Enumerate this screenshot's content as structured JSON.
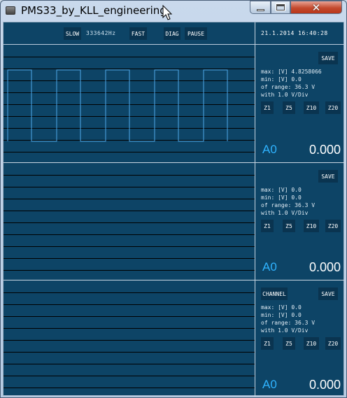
{
  "window": {
    "title": "PMS33_by_KLL_engineering",
    "close_glyph": "✕"
  },
  "toolbar": {
    "slow_label": "SLOW",
    "frequency": "333642Hz",
    "fast_label": "FAST",
    "diag_label": "DIAG",
    "pause_label": "PAUSE",
    "datetime": "21.1.2014 16:40:28"
  },
  "channels": [
    {
      "save_label": "SAVE",
      "max_line": "max: [V] 4.8258066",
      "min_line": "min: [V] 0.0",
      "range_line": "of range: 36.3 V",
      "div_line": "with 1.0 V/Div",
      "zoom": [
        "Z1",
        "Z5",
        "Z10",
        "Z20"
      ],
      "name": "A0",
      "value": "0.000"
    },
    {
      "save_label": "SAVE",
      "max_line": "max: [V] 0.0",
      "min_line": "min: [V] 0.0",
      "range_line": "of range: 36.3 V",
      "div_line": "with 1.0 V/Div",
      "zoom": [
        "Z1",
        "Z5",
        "Z10",
        "Z20"
      ],
      "name": "A0",
      "value": "0.000"
    },
    {
      "channel_label": "CHANNEL",
      "save_label": "SAVE",
      "max_line": "max: [V] 0.0",
      "min_line": "min: [V] 0.0",
      "range_line": "of range: 36.3 V",
      "div_line": "with 1.0 V/Div",
      "zoom": [
        "Z1",
        "Z5",
        "Z10",
        "Z20"
      ],
      "name": "A0",
      "value": "0.000"
    }
  ],
  "colors": {
    "background": "#0d4466",
    "trace": "#4fa8e8",
    "channel_label": "#2fb3ff"
  }
}
